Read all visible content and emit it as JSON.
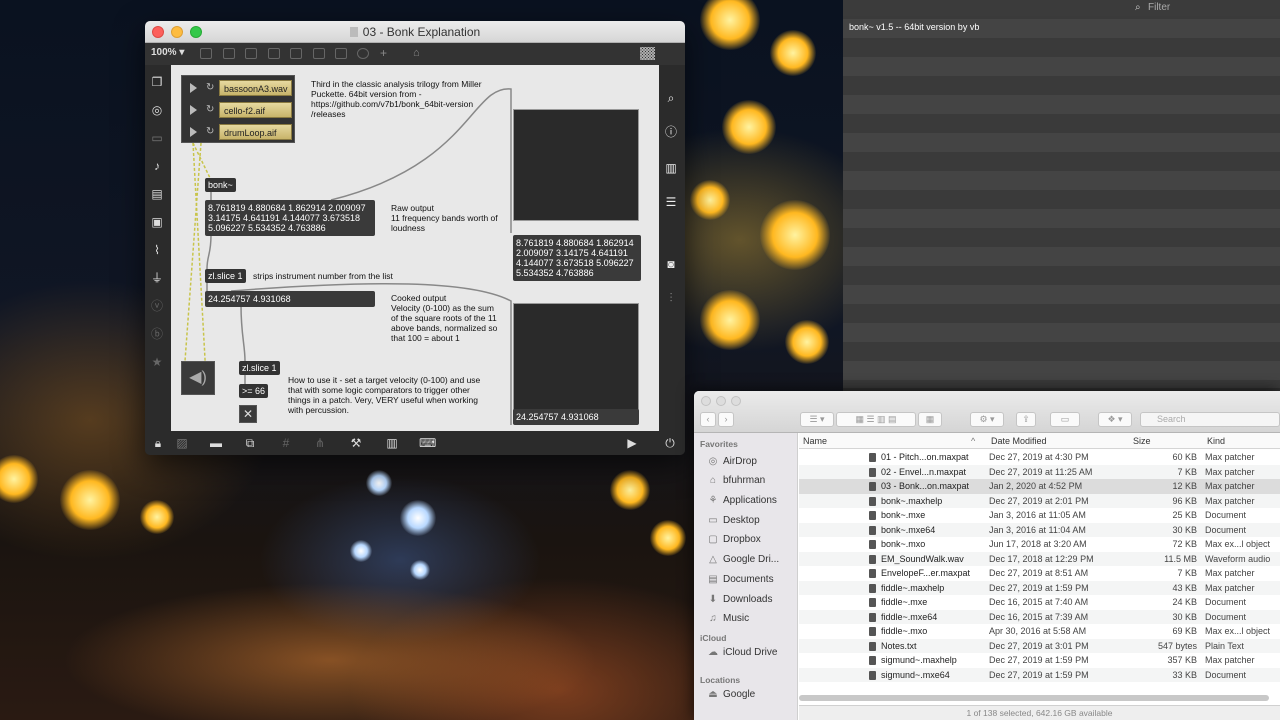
{
  "max_window": {
    "title": "03 - Bonk Explanation",
    "zoom": "100%",
    "sfplay_files": [
      "bassoonA3.wav",
      "cello-f2.aif",
      "drumLoop.aif"
    ],
    "objects": {
      "bonk": "bonk~",
      "zl_slice_1": "zl.slice 1",
      "zl_slice_2": "zl.slice 1",
      "compare": ">= 66"
    },
    "messages": {
      "raw_values": "8.761819 4.880684 1.862914 2.009097 3.14175 4.641191 4.144077 3.673518 5.096227 5.534352 4.763886",
      "cooked_values": "24.254757 4.931068",
      "raw_values_right": "8.761819 4.880684 1.862914 2.009097 3.14175 4.641191 4.144077 3.673518 5.096227 5.534352 4.763886",
      "cooked_values_right": "24.254757 4.931068"
    },
    "comments": {
      "intro": "Third in the classic analysis trilogy from Miller Puckette. 64bit version from - https://github.com/v7b1/bonk_64bit-version /releases",
      "raw_output": "Raw output\n11 frequency bands worth of loudness",
      "strips": "strips instrument number from the list",
      "cooked_output": "Cooked output\nVelocity (0-100) as the sum of the square roots of the 11 above bands, normalized so that 100 = about 1",
      "how_to": "How to use it - set a target velocity (0-100) and use that with some logic comparators to trigger other things in a patch. Very, VERY useful when working with percussion."
    },
    "toggle_symbol": "✕"
  },
  "console": {
    "filter_placeholder": "Filter",
    "line": "bonk~ v1.5 -- 64bit version by vb"
  },
  "finder": {
    "search_placeholder": "Search",
    "sidebar": {
      "favorites_label": "Favorites",
      "favorites": [
        {
          "label": "AirDrop",
          "icon": "airdrop-icon"
        },
        {
          "label": "bfuhrman",
          "icon": "home-icon"
        },
        {
          "label": "Applications",
          "icon": "applications-icon"
        },
        {
          "label": "Desktop",
          "icon": "desktop-icon"
        },
        {
          "label": "Dropbox",
          "icon": "dropbox-icon"
        },
        {
          "label": "Google Dri...",
          "icon": "google-drive-icon"
        },
        {
          "label": "Documents",
          "icon": "documents-icon"
        },
        {
          "label": "Downloads",
          "icon": "downloads-icon"
        },
        {
          "label": "Music",
          "icon": "music-icon"
        }
      ],
      "icloud_label": "iCloud",
      "icloud": [
        {
          "label": "iCloud Drive",
          "icon": "cloud-icon"
        }
      ],
      "locations_label": "Locations",
      "locations": [
        {
          "label": "Google",
          "icon": "disk-icon"
        }
      ]
    },
    "columns": {
      "name": "Name",
      "date": "Date Modified",
      "size": "Size",
      "kind": "Kind"
    },
    "rows": [
      {
        "name": "01 - Pitch...on.maxpat",
        "date": "Dec 27, 2019 at 4:30 PM",
        "size": "60 KB",
        "kind": "Max patcher"
      },
      {
        "name": "02 - Envel...n.maxpat",
        "date": "Dec 27, 2019 at 11:25 AM",
        "size": "7 KB",
        "kind": "Max patcher"
      },
      {
        "name": "03 - Bonk...on.maxpat",
        "date": "Jan 2, 2020 at 4:52 PM",
        "size": "12 KB",
        "kind": "Max patcher"
      },
      {
        "name": "bonk~.maxhelp",
        "date": "Dec 27, 2019 at 2:01 PM",
        "size": "96 KB",
        "kind": "Max patcher"
      },
      {
        "name": "bonk~.mxe",
        "date": "Jan 3, 2016 at 11:05 AM",
        "size": "25 KB",
        "kind": "Document"
      },
      {
        "name": "bonk~.mxe64",
        "date": "Jan 3, 2016 at 11:04 AM",
        "size": "30 KB",
        "kind": "Document"
      },
      {
        "name": "bonk~.mxo",
        "date": "Jun 17, 2018 at 3:20 AM",
        "size": "72 KB",
        "kind": "Max ex...l object"
      },
      {
        "name": "EM_SoundWalk.wav",
        "date": "Dec 17, 2018 at 12:29 PM",
        "size": "11.5 MB",
        "kind": "Waveform audio"
      },
      {
        "name": "EnvelopeF...er.maxpat",
        "date": "Dec 27, 2019 at 8:51 AM",
        "size": "7 KB",
        "kind": "Max patcher"
      },
      {
        "name": "fiddle~.maxhelp",
        "date": "Dec 27, 2019 at 1:59 PM",
        "size": "43 KB",
        "kind": "Max patcher"
      },
      {
        "name": "fiddle~.mxe",
        "date": "Dec 16, 2015 at 7:40 AM",
        "size": "24 KB",
        "kind": "Document"
      },
      {
        "name": "fiddle~.mxe64",
        "date": "Dec 16, 2015 at 7:39 AM",
        "size": "30 KB",
        "kind": "Document"
      },
      {
        "name": "fiddle~.mxo",
        "date": "Apr 30, 2016 at 5:58 AM",
        "size": "69 KB",
        "kind": "Max ex...l object"
      },
      {
        "name": "Notes.txt",
        "date": "Dec 27, 2019 at 3:01 PM",
        "size": "547 bytes",
        "kind": "Plain Text"
      },
      {
        "name": "sigmund~.maxhelp",
        "date": "Dec 27, 2019 at 1:59 PM",
        "size": "357 KB",
        "kind": "Max patcher"
      },
      {
        "name": "sigmund~.mxe64",
        "date": "Dec 27, 2019 at 1:59 PM",
        "size": "33 KB",
        "kind": "Document"
      }
    ],
    "status": "1 of 138 selected, 642.16 GB available"
  }
}
